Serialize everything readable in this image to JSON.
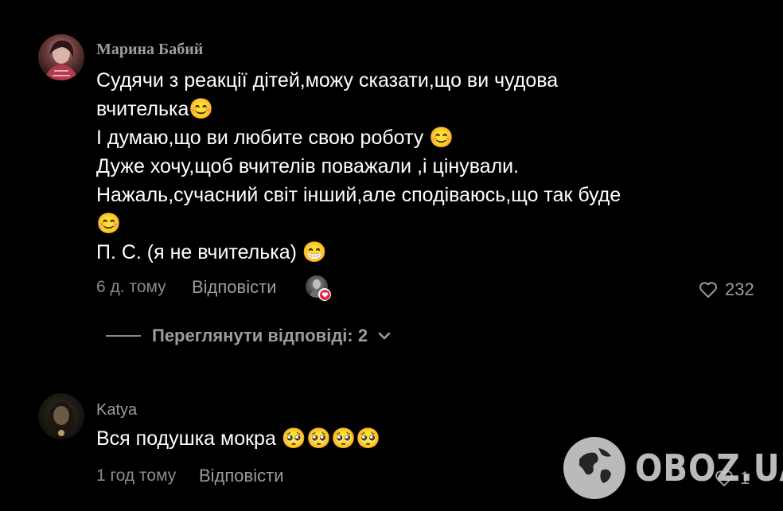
{
  "comments": [
    {
      "author": "Марина Бабий",
      "text_lines": [
        "Судячи з реакції дітей,можу сказати,що ви чудова",
        "вчителька😊",
        "І думаю,що ви любите свою роботу 😊",
        "Дуже хочу,щоб вчителів поважали ,і цінували.",
        "Нажаль,сучасний світ інший,але сподіваюсь,що так буде",
        "😊",
        "П. С. (я не вчителька) 😁"
      ],
      "time": "6 д. тому",
      "reply_label": "Відповісти",
      "like_count": "232",
      "view_replies_label": "Переглянути відповіді: 2"
    },
    {
      "author": "Katya",
      "text_lines": [
        "Вся подушка мокра 🥺🥺🥺🥺"
      ],
      "time": "1 год тому",
      "reply_label": "Відповісти",
      "like_count": "1"
    }
  ],
  "watermark": {
    "text": "OBOZ.UA"
  },
  "colors": {
    "background": "#000000",
    "secondary_text": "#9c9c9c",
    "creator_like_badge": "#e8264a"
  }
}
